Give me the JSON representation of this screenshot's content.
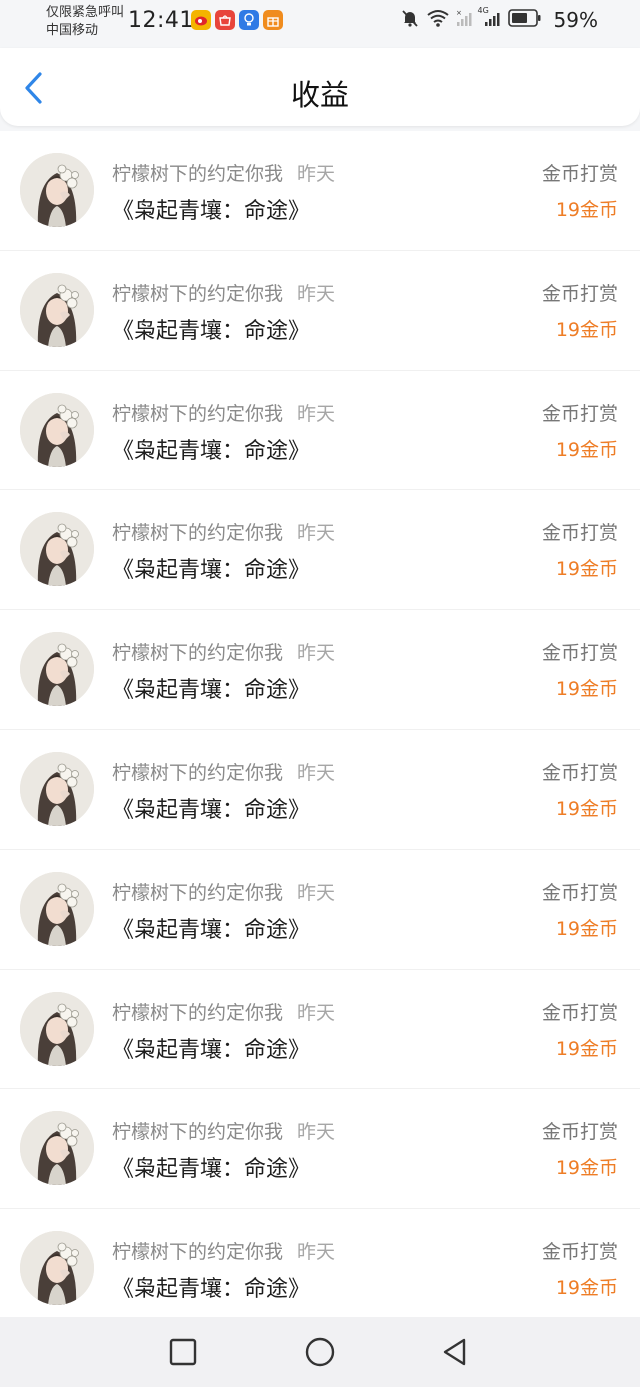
{
  "status_bar": {
    "carrier_line1": "仅限紧急呼叫",
    "carrier_line2": "中国移动",
    "time": "12:41",
    "network": "4G",
    "battery": "59%",
    "app_icons": [
      {
        "name": "weibo-app-icon",
        "color": "#f4b400"
      },
      {
        "name": "huawei-store-icon",
        "color": "#e8453c"
      },
      {
        "name": "lightbulb-app-icon",
        "color": "#2f7ae5"
      },
      {
        "name": "gift-app-icon",
        "color": "#f08c1e"
      }
    ]
  },
  "header": {
    "title": "收益",
    "back_icon": "chevron-left-icon",
    "accent": "#2f86e8"
  },
  "earnings": {
    "amount_color": "#ee7d26",
    "items": [
      {
        "user": "柠檬树下的约定你我",
        "date": "昨天",
        "book": "《枭起青壤：命途》",
        "type": "金币打赏",
        "amount": "19金币"
      },
      {
        "user": "柠檬树下的约定你我",
        "date": "昨天",
        "book": "《枭起青壤：命途》",
        "type": "金币打赏",
        "amount": "19金币"
      },
      {
        "user": "柠檬树下的约定你我",
        "date": "昨天",
        "book": "《枭起青壤：命途》",
        "type": "金币打赏",
        "amount": "19金币"
      },
      {
        "user": "柠檬树下的约定你我",
        "date": "昨天",
        "book": "《枭起青壤：命途》",
        "type": "金币打赏",
        "amount": "19金币"
      },
      {
        "user": "柠檬树下的约定你我",
        "date": "昨天",
        "book": "《枭起青壤：命途》",
        "type": "金币打赏",
        "amount": "19金币"
      },
      {
        "user": "柠檬树下的约定你我",
        "date": "昨天",
        "book": "《枭起青壤：命途》",
        "type": "金币打赏",
        "amount": "19金币"
      },
      {
        "user": "柠檬树下的约定你我",
        "date": "昨天",
        "book": "《枭起青壤：命途》",
        "type": "金币打赏",
        "amount": "19金币"
      },
      {
        "user": "柠檬树下的约定你我",
        "date": "昨天",
        "book": "《枭起青壤：命途》",
        "type": "金币打赏",
        "amount": "19金币"
      },
      {
        "user": "柠檬树下的约定你我",
        "date": "昨天",
        "book": "《枭起青壤：命途》",
        "type": "金币打赏",
        "amount": "19金币"
      },
      {
        "user": "柠檬树下的约定你我",
        "date": "昨天",
        "book": "《枭起青壤：命途》",
        "type": "金币打赏",
        "amount": "19金币"
      }
    ]
  },
  "nav_bar": {
    "buttons": [
      "recent-apps-square-icon",
      "home-circle-icon",
      "back-triangle-icon"
    ]
  }
}
